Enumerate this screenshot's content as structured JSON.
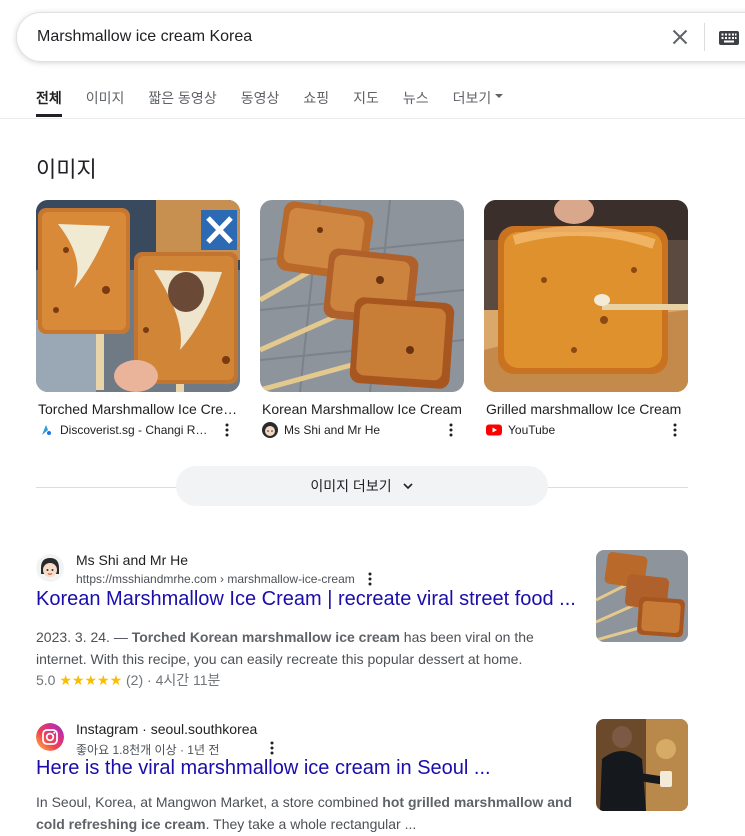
{
  "search": {
    "query": "Marshmallow ice cream Korea"
  },
  "tabs": [
    {
      "label": "전체"
    },
    {
      "label": "이미지"
    },
    {
      "label": "짧은 동영상"
    },
    {
      "label": "동영상"
    },
    {
      "label": "쇼핑"
    },
    {
      "label": "지도"
    },
    {
      "label": "뉴스"
    },
    {
      "label": "더보기"
    }
  ],
  "images": {
    "heading": "이미지",
    "items": [
      {
        "title": "Torched Marshmallow Ice Cream",
        "source": "Discoverist.sg - Changi Recommends",
        "icon": "discoverist-icon"
      },
      {
        "title": "Korean Marshmallow Ice Cream",
        "source": "Ms Shi and Mr He",
        "icon": "mshi-avatar-icon"
      },
      {
        "title": "Grilled marshmallow Ice Cream",
        "source": "YouTube",
        "icon": "youtube-icon"
      }
    ],
    "more_label": "이미지 더보기"
  },
  "results": [
    {
      "site": "Ms Shi and Mr He",
      "url": "https://msshiandmrhe.com › marshmallow-ice-cream",
      "title": "Korean Marshmallow Ice Cream | recreate viral street food ...",
      "snippet_date": "2023. 3. 24. — ",
      "snippet_bold": "Torched Korean marshmallow ice cream",
      "snippet_rest": " has been viral on the internet. With this recipe, you can easily recreate this popular dessert at home.",
      "rating": "5.0",
      "stars": "★★★★★",
      "rating_count": "(2)",
      "duration": "· 4시간 11분"
    },
    {
      "site": "Instagram · seoul.southkorea",
      "url": "좋아요 1.8천개 이상 · 1년 전",
      "title": "Here is the viral marshmallow ice cream in Seoul ...",
      "snippet_a": "In Seoul, Korea, at Mangwon Market, a store combined ",
      "snippet_bold": "hot grilled marshmallow and cold refreshing ice cream",
      "snippet_b": ". They take a whole rectangular ..."
    }
  ],
  "colors": {
    "link": "#1a0dab",
    "stars": "#fbbc04",
    "youtube": "#ff0000"
  }
}
